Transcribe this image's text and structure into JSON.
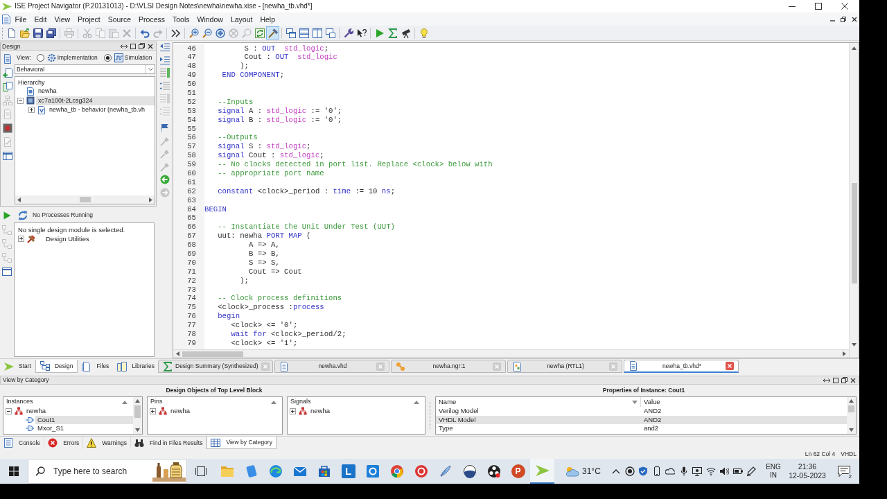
{
  "window": {
    "title": "ISE Project Navigator (P.20131013) - D:\\VLSI Design Notes\\newha\\newha.xise - [newha_tb.vhd*]"
  },
  "menu": [
    "File",
    "Edit",
    "View",
    "Project",
    "Source",
    "Process",
    "Tools",
    "Window",
    "Layout",
    "Help"
  ],
  "toolbar": [
    [
      {
        "disabled": false,
        "pressed": false
      },
      {
        "disabled": false,
        "pressed": false
      },
      {
        "disabled": false,
        "pressed": false
      },
      {
        "disabled": false,
        "pressed": false
      }
    ],
    [
      {
        "disabled": true,
        "pressed": false
      }
    ],
    [
      {
        "disabled": true,
        "pressed": false
      },
      {
        "disabled": true,
        "pressed": false
      },
      {
        "disabled": true,
        "pressed": false
      },
      {
        "disabled": true,
        "pressed": false
      }
    ],
    [
      {
        "disabled": false,
        "pressed": false
      },
      {
        "disabled": true,
        "pressed": false
      }
    ],
    [
      {
        "disabled": false,
        "pressed": false
      }
    ],
    [
      {
        "disabled": false,
        "pressed": false
      },
      {
        "disabled": false,
        "pressed": false
      },
      {
        "disabled": false,
        "pressed": false
      },
      {
        "disabled": true,
        "pressed": false
      },
      {
        "disabled": true,
        "pressed": false
      },
      {
        "disabled": false,
        "pressed": false
      },
      {
        "disabled": false,
        "pressed": true
      }
    ],
    [
      {
        "disabled": false,
        "pressed": false
      },
      {
        "disabled": false,
        "pressed": false
      },
      {
        "disabled": false,
        "pressed": false
      },
      {
        "disabled": false,
        "pressed": false
      }
    ],
    [
      {
        "disabled": false,
        "pressed": false
      },
      {
        "disabled": false,
        "pressed": false
      }
    ],
    [
      {
        "disabled": false,
        "pressed": false
      },
      {
        "disabled": false,
        "pressed": false
      },
      {
        "disabled": false,
        "pressed": false
      }
    ],
    [
      {
        "disabled": false,
        "pressed": false
      }
    ]
  ],
  "design_panel": {
    "title": "Design",
    "tools": [
      {
        "disabled": false
      },
      {
        "disabled": false
      },
      {
        "disabled": false
      },
      {
        "disabled": true
      },
      {
        "disabled": true
      },
      {
        "disabled": false
      },
      {
        "disabled": true
      },
      {
        "disabled": false
      }
    ],
    "view_label": "View:",
    "view_options": [
      {
        "label": "Implementation",
        "selected": false
      },
      {
        "label": "Simulation",
        "selected": true
      }
    ],
    "filter": "Behavioral",
    "hierarchy_title": "Hierarchy",
    "hierarchy": [
      {
        "label": "newha",
        "kind": "project",
        "selected": false
      },
      {
        "label": "xc7a100t-2Lcsg324",
        "kind": "device",
        "expanded": true,
        "selected": true,
        "children": [
          {
            "label": "newha_tb - behavior (newha_tb.vh",
            "kind": "testbench",
            "expanded": false,
            "selected": false
          }
        ]
      }
    ]
  },
  "processes": {
    "tools": [
      {
        "disabled": true
      },
      {
        "disabled": true
      },
      {
        "disabled": true
      },
      {
        "disabled": false
      }
    ],
    "status": "No Processes Running",
    "message": "No single design module is selected.",
    "items": [
      {
        "label": "Design Utilities",
        "kind": "utilities",
        "expanded": false,
        "selected": false
      }
    ]
  },
  "editor_tools": [
    {
      "disabled": false
    },
    {
      "disabled": false
    },
    {
      "disabled": false
    },
    {
      "disabled": false
    },
    {
      "disabled": true
    },
    {
      "disabled": true
    },
    {
      "disabled": false
    },
    {
      "disabled": true
    },
    {
      "disabled": true
    },
    {
      "disabled": true
    },
    {
      "disabled": false
    },
    {
      "disabled": true
    }
  ],
  "editor": {
    "lines": [
      {
        "number": "46",
        "tokens": [
          {
            "kind": "plain",
            "text": "         S : "
          },
          {
            "kind": "keyword",
            "text": "OUT  "
          },
          {
            "kind": "type",
            "text": "std_logic"
          },
          {
            "kind": "plain",
            "text": ";"
          }
        ]
      },
      {
        "number": "47",
        "tokens": [
          {
            "kind": "plain",
            "text": "         Cout : "
          },
          {
            "kind": "keyword",
            "text": "OUT  "
          },
          {
            "kind": "type",
            "text": "std_logic"
          }
        ]
      },
      {
        "number": "48",
        "tokens": [
          {
            "kind": "plain",
            "text": "        );"
          }
        ]
      },
      {
        "number": "49",
        "tokens": [
          {
            "kind": "keyword",
            "text": "    END COMPONENT"
          },
          {
            "kind": "plain",
            "text": ";"
          }
        ]
      },
      {
        "number": "50"
      },
      {
        "number": "51"
      },
      {
        "number": "52",
        "tokens": [
          {
            "kind": "comment",
            "text": "   --Inputs"
          }
        ]
      },
      {
        "number": "53",
        "tokens": [
          {
            "kind": "keyword",
            "text": "   signal"
          },
          {
            "kind": "plain",
            "text": " A : "
          },
          {
            "kind": "type",
            "text": "std_logic"
          },
          {
            "kind": "plain",
            "text": " := '0';"
          }
        ]
      },
      {
        "number": "54",
        "tokens": [
          {
            "kind": "keyword",
            "text": "   signal"
          },
          {
            "kind": "plain",
            "text": " B : "
          },
          {
            "kind": "type",
            "text": "std_logic"
          },
          {
            "kind": "plain",
            "text": " := '0';"
          }
        ]
      },
      {
        "number": "55"
      },
      {
        "number": "56",
        "tokens": [
          {
            "kind": "comment",
            "text": "   --Outputs"
          }
        ]
      },
      {
        "number": "57",
        "tokens": [
          {
            "kind": "keyword",
            "text": "   signal"
          },
          {
            "kind": "plain",
            "text": " S : "
          },
          {
            "kind": "type",
            "text": "std_logic"
          },
          {
            "kind": "plain",
            "text": ";"
          }
        ]
      },
      {
        "number": "58",
        "tokens": [
          {
            "kind": "keyword",
            "text": "   signal"
          },
          {
            "kind": "plain",
            "text": " Cout : "
          },
          {
            "kind": "type",
            "text": "std_logic"
          },
          {
            "kind": "plain",
            "text": ";"
          }
        ]
      },
      {
        "number": "59",
        "tokens": [
          {
            "kind": "comment",
            "text": "   -- No clocks detected in port list. Replace <clock> below with"
          }
        ]
      },
      {
        "number": "60",
        "tokens": [
          {
            "kind": "comment",
            "text": "   -- appropriate port name"
          }
        ]
      },
      {
        "number": "61"
      },
      {
        "number": "62",
        "tokens": [
          {
            "kind": "keyword",
            "text": "   constant"
          },
          {
            "kind": "plain",
            "text": " <clock>_period : "
          },
          {
            "kind": "keyword",
            "text": "time"
          },
          {
            "kind": "plain",
            "text": " := 10 "
          },
          {
            "kind": "keyword",
            "text": "ns"
          },
          {
            "kind": "plain",
            "text": ";"
          }
        ]
      },
      {
        "number": "63"
      },
      {
        "number": "64",
        "tokens": [
          {
            "kind": "keyword",
            "text": "BEGIN"
          }
        ]
      },
      {
        "number": "65"
      },
      {
        "number": "66",
        "tokens": [
          {
            "kind": "comment",
            "text": "   -- Instantiate the Unit Under Test (UUT)"
          }
        ]
      },
      {
        "number": "67",
        "tokens": [
          {
            "kind": "plain",
            "text": "   uut: newha "
          },
          {
            "kind": "keyword",
            "text": "PORT MAP"
          },
          {
            "kind": "plain",
            "text": " ("
          }
        ]
      },
      {
        "number": "68",
        "tokens": [
          {
            "kind": "plain",
            "text": "          A => A,"
          }
        ]
      },
      {
        "number": "69",
        "tokens": [
          {
            "kind": "plain",
            "text": "          B => B,"
          }
        ]
      },
      {
        "number": "70",
        "tokens": [
          {
            "kind": "plain",
            "text": "          S => S,"
          }
        ]
      },
      {
        "number": "71",
        "tokens": [
          {
            "kind": "plain",
            "text": "          Cout => Cout"
          }
        ]
      },
      {
        "number": "72",
        "tokens": [
          {
            "kind": "plain",
            "text": "        );"
          }
        ]
      },
      {
        "number": "73"
      },
      {
        "number": "74",
        "tokens": [
          {
            "kind": "comment",
            "text": "   -- Clock process definitions"
          }
        ]
      },
      {
        "number": "75",
        "tokens": [
          {
            "kind": "plain",
            "text": "   <clock>_process :"
          },
          {
            "kind": "keyword",
            "text": "process"
          }
        ]
      },
      {
        "number": "76",
        "tokens": [
          {
            "kind": "keyword",
            "text": "   begin"
          }
        ]
      },
      {
        "number": "77",
        "tokens": [
          {
            "kind": "plain",
            "text": "      <clock> <= '0';"
          }
        ]
      },
      {
        "number": "78",
        "tokens": [
          {
            "kind": "keyword",
            "text": "      wait for"
          },
          {
            "kind": "plain",
            "text": " <clock>_period/2;"
          }
        ]
      },
      {
        "number": "79",
        "tokens": [
          {
            "kind": "plain",
            "text": "      <clock> <= '1';"
          }
        ]
      }
    ]
  },
  "left_tabs": [
    {
      "label": "Start",
      "selected": false
    },
    {
      "label": "Design",
      "selected": true
    },
    {
      "label": "Files",
      "selected": false
    },
    {
      "label": "Libraries",
      "selected": false
    }
  ],
  "editor_tabs": [
    {
      "label": "Design Summary (Synthesized)",
      "kind": "summary",
      "selected": false
    },
    {
      "label": "newha.vhd",
      "kind": "vhdl",
      "selected": false
    },
    {
      "label": "newha.ngr:1",
      "kind": "netlist",
      "selected": false
    },
    {
      "label": "newha (RTL1)",
      "kind": "schematic",
      "selected": false
    },
    {
      "label": "newha_tb.vhd*",
      "kind": "vhdl",
      "selected": true
    }
  ],
  "category_view": {
    "title": "View by Category",
    "objects_title": "Design Objects of Top Level Block",
    "properties_title": "Properties of Instance: Cout1",
    "instances": {
      "header": "Instances",
      "items": [
        {
          "label": "newha",
          "kind": "module",
          "expanded": true,
          "selected": false,
          "children": [
            {
              "label": "Cout1",
              "kind": "gate",
              "selected": true
            },
            {
              "label": "Mxor_S1",
              "kind": "gate",
              "selected": false
            }
          ]
        }
      ]
    },
    "pins": {
      "header": "Pins",
      "items": [
        {
          "label": "newha",
          "kind": "module",
          "expanded": false,
          "selected": false
        }
      ]
    },
    "signals": {
      "header": "Signals",
      "items": [
        {
          "label": "newha",
          "kind": "module",
          "expanded": false,
          "selected": false
        }
      ]
    },
    "properties": {
      "columns": [
        "Name",
        "Value"
      ],
      "rows": [
        {
          "cells": [
            "Verilog Model",
            "AND2"
          ],
          "selected": false
        },
        {
          "cells": [
            "VHDL Model",
            "AND2"
          ],
          "selected": true
        },
        {
          "cells": [
            "Type",
            "and2"
          ],
          "selected": false
        }
      ]
    }
  },
  "bottom_tabs": [
    {
      "label": "Console",
      "selected": false
    },
    {
      "label": "Errors",
      "selected": false
    },
    {
      "label": "Warnings",
      "selected": false
    },
    {
      "label": "Find in Files Results",
      "selected": false
    },
    {
      "label": "View by Category",
      "selected": true
    }
  ],
  "status_bar": {
    "position": "Ln 62 Col 4",
    "language": "VHDL"
  },
  "taskbar": {
    "search": {
      "placeholder": "Type here to search"
    },
    "apps": [
      {
        "active": false
      },
      {
        "active": false
      },
      {
        "active": false
      },
      {
        "active": false
      },
      {
        "active": false
      },
      {
        "letter": "L",
        "active": false
      },
      {
        "active": false
      },
      {
        "active": false
      },
      {
        "active": false
      },
      {
        "active": false
      },
      {
        "active": false
      },
      {
        "active": false
      },
      {
        "letter": "P",
        "active": false
      },
      {
        "active": true
      }
    ],
    "weather": "31°C",
    "input_language": "ENG",
    "input_region": "IN",
    "time": "21:36",
    "date": "12-05-2023",
    "notifications": "2"
  }
}
